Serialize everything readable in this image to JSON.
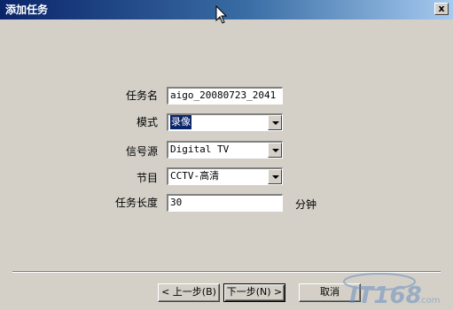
{
  "window": {
    "title": "添加任务",
    "close_label": "x"
  },
  "form": {
    "task_name": {
      "label": "任务名",
      "value": "aigo_20080723_2041"
    },
    "mode": {
      "label": "模式",
      "value": "录像"
    },
    "signal_source": {
      "label": "信号源",
      "value": "Digital TV"
    },
    "program": {
      "label": "节目",
      "value": "CCTV-高清"
    },
    "duration": {
      "label": "任务长度",
      "value": "30",
      "unit": "分钟"
    }
  },
  "buttons": {
    "back": "< 上一步(B)",
    "next": "下一步(N) >",
    "cancel": "取消"
  },
  "watermark": {
    "text": "IT168",
    "suffix": ".com"
  },
  "colors": {
    "titlebar": "#0a246a",
    "face": "#d4d0c8",
    "selection": "#0a246a",
    "watermark": "#6a8fc0"
  },
  "icons": {
    "cursor": "mouse-pointer-icon",
    "close": "close-icon",
    "dropdown": "chevron-down-icon"
  }
}
